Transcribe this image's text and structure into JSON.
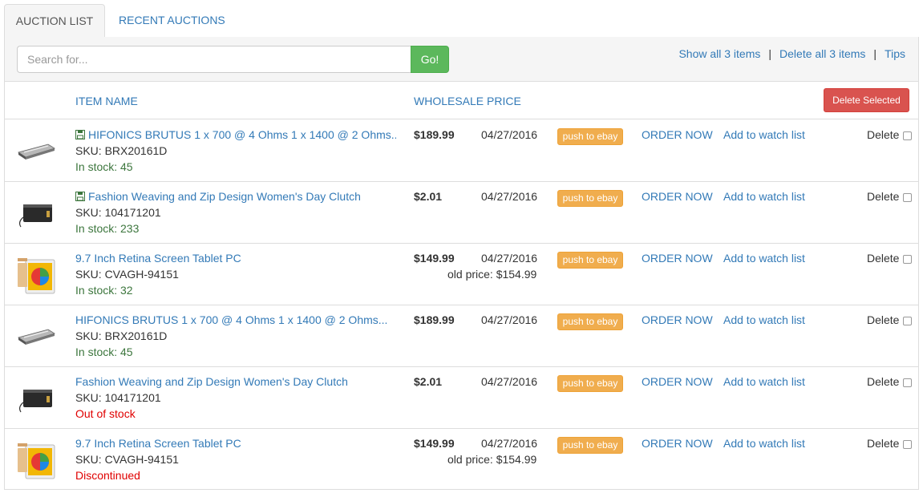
{
  "tabs": {
    "auction_list": "AUCTION LIST",
    "recent_auctions": "RECENT AUCTIONS"
  },
  "toolbar": {
    "search_placeholder": "Search for...",
    "go_label": "Go!",
    "show_all": "Show all 3 items",
    "delete_all": "Delete all 3 items",
    "tips": "Tips",
    "separator": "|"
  },
  "table": {
    "headers": {
      "item_name": "ITEM NAME",
      "wholesale_price": "WHOLESALE PRICE"
    },
    "delete_selected": "Delete Selected",
    "rows": [
      {
        "thumb": "amplifier",
        "saved": true,
        "name": "HIFONICS BRUTUS 1 x 700 @ 4 Ohms 1 x 1400 @ 2 Ohms...",
        "sku": "SKU: BRX20161D",
        "stock": "In stock: 45",
        "stock_status": "ok",
        "price": "$189.99",
        "date": "04/27/2016",
        "old_price": "",
        "push": "push to ebay",
        "order": "ORDER NOW",
        "watch": "Add to watch list",
        "delete": "Delete"
      },
      {
        "thumb": "clutch",
        "saved": true,
        "name": "Fashion Weaving and Zip Design Women's Day Clutch",
        "sku": "SKU: 104171201",
        "stock": "In stock: 233",
        "stock_status": "ok",
        "price": "$2.01",
        "date": "04/27/2016",
        "old_price": "",
        "push": "push to ebay",
        "order": "ORDER NOW",
        "watch": "Add to watch list",
        "delete": "Delete"
      },
      {
        "thumb": "tablet",
        "saved": false,
        "name": "9.7 Inch Retina Screen Tablet PC",
        "sku": "SKU: CVAGH-94151",
        "stock": "In stock: 32",
        "stock_status": "ok",
        "price": "$149.99",
        "date": "04/27/2016",
        "old_price": "old price: $154.99",
        "push": "push to ebay",
        "order": "ORDER NOW",
        "watch": "Add to watch list",
        "delete": "Delete"
      },
      {
        "thumb": "amplifier",
        "saved": false,
        "name": "HIFONICS BRUTUS 1 x 700 @ 4 Ohms 1 x 1400 @ 2 Ohms...",
        "sku": "SKU: BRX20161D",
        "stock": "In stock: 45",
        "stock_status": "ok",
        "price": "$189.99",
        "date": "04/27/2016",
        "old_price": "",
        "push": "push to ebay",
        "order": "ORDER NOW",
        "watch": "Add to watch list",
        "delete": "Delete"
      },
      {
        "thumb": "clutch",
        "saved": false,
        "name": "Fashion Weaving and Zip Design Women's Day Clutch",
        "sku": "SKU: 104171201",
        "stock": "Out of stock",
        "stock_status": "bad",
        "price": "$2.01",
        "date": "04/27/2016",
        "old_price": "",
        "push": "push to ebay",
        "order": "ORDER NOW",
        "watch": "Add to watch list",
        "delete": "Delete"
      },
      {
        "thumb": "tablet",
        "saved": false,
        "name": "9.7 Inch Retina Screen Tablet PC",
        "sku": "SKU: CVAGH-94151",
        "stock": "Discontinued",
        "stock_status": "bad",
        "price": "$149.99",
        "date": "04/27/2016",
        "old_price": "old price: $154.99",
        "push": "push to ebay",
        "order": "ORDER NOW",
        "watch": "Add to watch list",
        "delete": "Delete"
      }
    ]
  },
  "colors": {
    "link": "#337ab7",
    "go": "#5cb85c",
    "danger": "#d9534f",
    "warning": "#f0ad4e",
    "in_stock": "#3c763d",
    "out_stock": "#e00000"
  }
}
